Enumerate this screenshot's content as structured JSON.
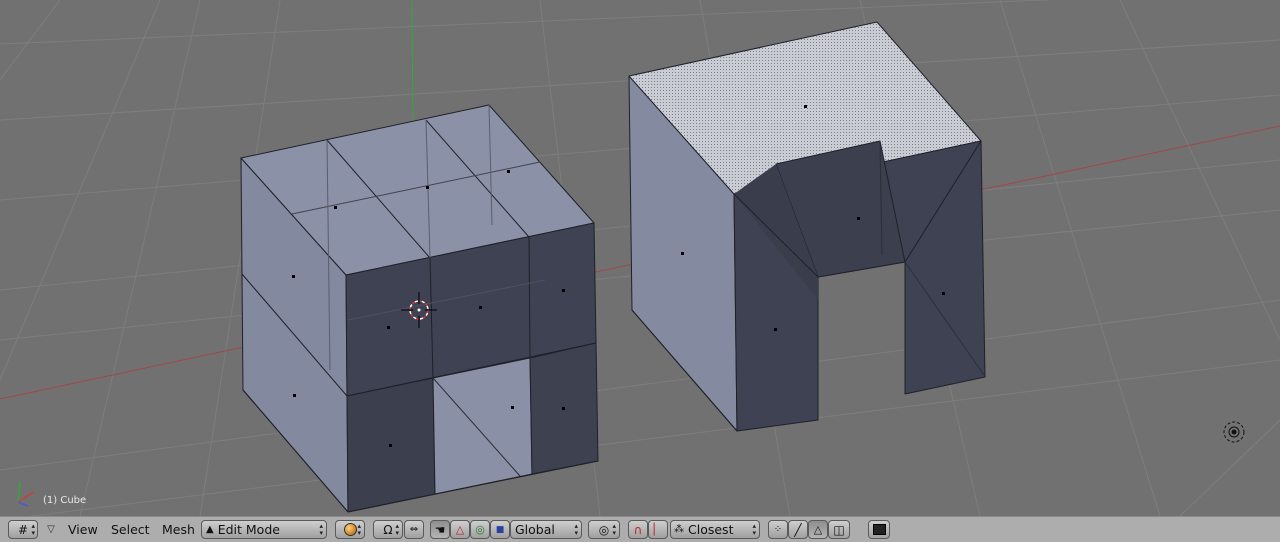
{
  "viewport": {
    "object_label": "(1) Cube"
  },
  "toolbar": {
    "view_label": "View",
    "select_label": "Select",
    "mesh_label": "Mesh",
    "mode_selected": "Edit Mode",
    "orientation_selected": "Global",
    "snap_target_selected": "Closest",
    "icons": [
      "editor-type-icon",
      "collapse-triangle-icon",
      "shading-sphere-icon",
      "pivot-icon",
      "manipulator-hand-icon",
      "translate-icon",
      "rotate-icon",
      "scale-icon",
      "proportional-edit-icon",
      "snap-magnet-icon",
      "snap-element-icon",
      "vertex-select-icon",
      "edge-select-icon",
      "face-select-icon",
      "occlude-geometry-icon",
      "render-icon"
    ]
  },
  "colors": {
    "viewport_bg": "#717171",
    "mesh_face_light": "#8c93a8",
    "mesh_face_dark": "#3d4150",
    "toolbar_bg": "#adadad",
    "x_axis": "#b34a4a",
    "y_axis": "#3fa83f"
  }
}
